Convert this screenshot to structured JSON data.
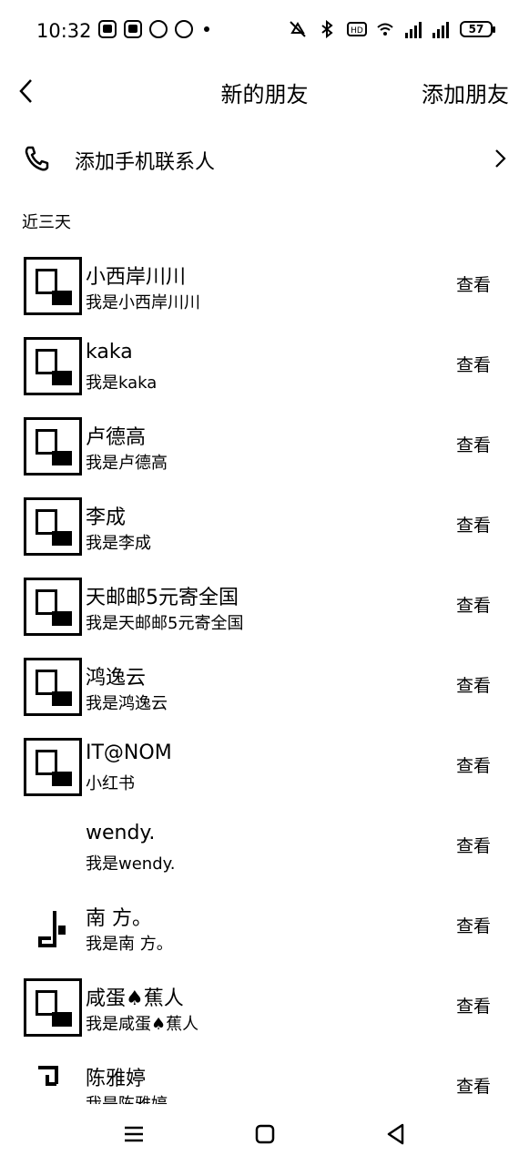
{
  "status_bar": {
    "time": "10:32",
    "battery": "57",
    "icons": [
      "mute-icon",
      "bluetooth-icon",
      "hd-icon",
      "wifi-icon",
      "signal-4g-icon",
      "signal-4g-icon",
      "battery-icon"
    ]
  },
  "header": {
    "title": "新的朋友",
    "action": "添加朋友"
  },
  "add_contacts": {
    "label": "添加手机联系人"
  },
  "section": {
    "label": "近三天"
  },
  "friends": [
    {
      "name": "小西岸川川",
      "message": "我是小西岸川川",
      "action": "查看"
    },
    {
      "name": "kaka",
      "message": "我是kaka",
      "action": "查看"
    },
    {
      "name": "卢德高",
      "message": "我是卢德高",
      "action": "查看"
    },
    {
      "name": "李成",
      "message": "我是李成",
      "action": "查看"
    },
    {
      "name": "天邮邮5元寄全国",
      "message": "我是天邮邮5元寄全国",
      "action": "查看"
    },
    {
      "name": "鸿逸云",
      "message": "我是鸿逸云",
      "action": "查看"
    },
    {
      "name": "IT@NOM",
      "message": "小红书",
      "action": "查看"
    },
    {
      "name": "wendy.",
      "message": "我是wendy.",
      "action": "查看"
    },
    {
      "name": "南 方。",
      "message": "我是南 方。",
      "action": "查看"
    },
    {
      "name": "咸蛋♠蕉人",
      "message": "我是咸蛋♠蕉人",
      "action": "查看"
    },
    {
      "name": "陈雅婷",
      "message": "我是陈雅婷",
      "action": "查看"
    }
  ],
  "nav_bar": {
    "icons": [
      "menu-icon",
      "home-icon",
      "back-triangle-icon"
    ]
  }
}
